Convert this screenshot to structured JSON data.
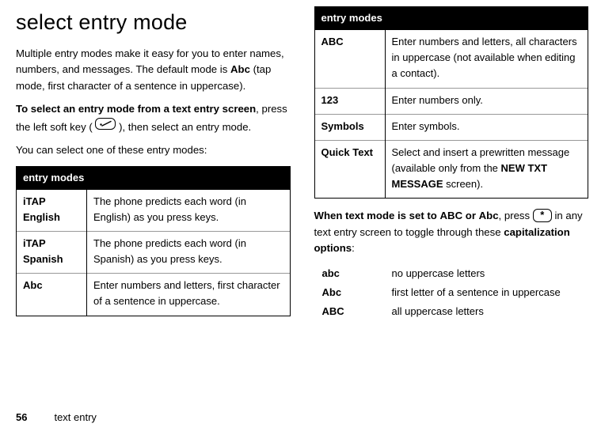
{
  "heading": "select entry mode",
  "left": {
    "p1a": "Multiple entry modes make it easy for you to enter names, numbers, and messages. The default mode is ",
    "p1b_abc": "Abc",
    "p1c": " (tap mode, first character of a sentence in uppercase).",
    "p2a": "To select an entry mode from a text entry screen",
    "p2b": ", press the left soft key ( ",
    "p2c": " ), then select an entry mode.",
    "p3": "You can select one of these entry modes:",
    "table_header": "entry modes",
    "rows": [
      {
        "name": "iTAP English",
        "desc": "The phone predicts each word (in English) as you press keys."
      },
      {
        "name": "iTAP Spanish",
        "desc": "The phone predicts each word (in Spanish) as you press keys."
      },
      {
        "name": "Abc",
        "desc": "Enter numbers and letters, first character of a sentence in uppercase."
      }
    ]
  },
  "right": {
    "table_header": "entry modes",
    "rows": [
      {
        "name": "ABC",
        "desc": "Enter numbers and letters, all characters in uppercase (not available when editing a contact)."
      },
      {
        "name": "123",
        "desc": "Enter numbers only."
      },
      {
        "name": "Symbols",
        "desc": "Enter symbols."
      }
    ],
    "qt_name": "Quick Text",
    "qt_desc_a": "Select and insert a prewritten message (available only from the ",
    "qt_desc_b": "NEW TXT MESSAGE",
    "qt_desc_c": " screen).",
    "p1a": "When text mode is set to ",
    "p1b": "ABC",
    "p1c": " or ",
    "p1d": "Abc",
    "p1e": ", press ",
    "star": "*",
    "p1f": " in any text entry screen to toggle through these ",
    "p1g": "capitalization options",
    "p1h": ":",
    "cap_rows": [
      {
        "name": "abc",
        "desc": "no uppercase letters"
      },
      {
        "name": "Abc",
        "desc": "first letter of a sentence in uppercase"
      },
      {
        "name": "ABC",
        "desc": "all uppercase letters"
      }
    ]
  },
  "footer": {
    "page": "56",
    "section": "text entry"
  }
}
